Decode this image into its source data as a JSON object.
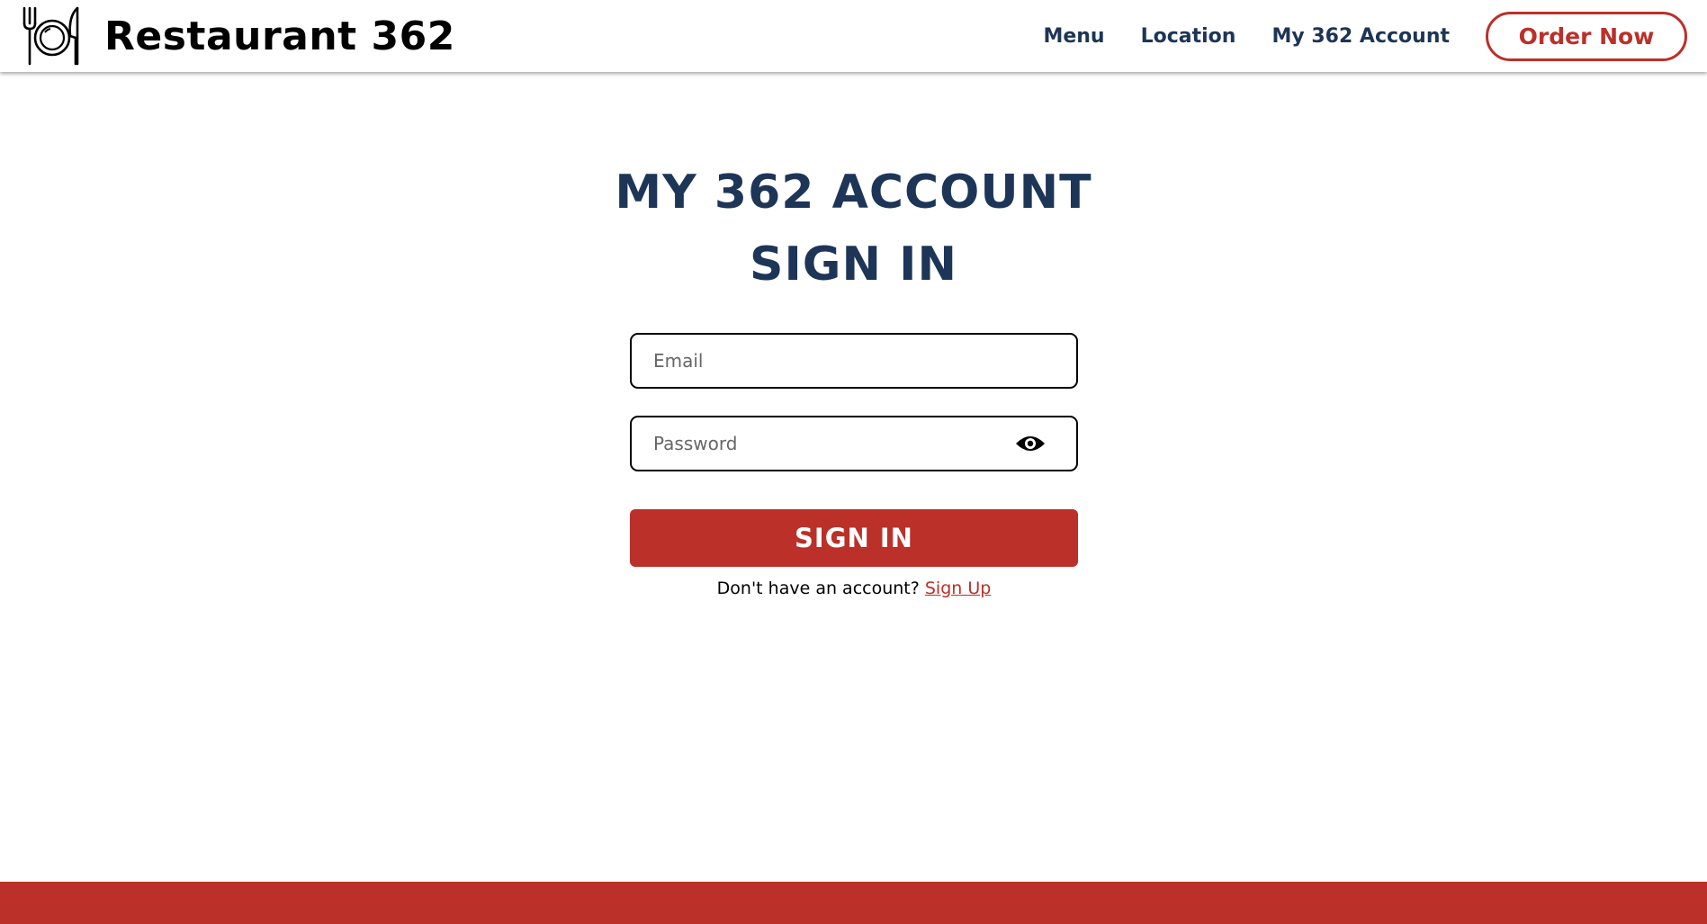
{
  "brand": {
    "name": "Restaurant 362",
    "logo_icon": "plate-fork-knife-icon"
  },
  "nav": {
    "items": [
      {
        "label": "Menu"
      },
      {
        "label": "Location"
      },
      {
        "label": "My 362 Account"
      }
    ],
    "order_button_label": "Order Now"
  },
  "page": {
    "title_line1": "MY 362 ACCOUNT",
    "title_line2": "SIGN IN"
  },
  "form": {
    "email": {
      "value": "",
      "placeholder": "Email"
    },
    "password": {
      "value": "",
      "placeholder": "Password",
      "toggle_icon": "eye-icon"
    },
    "submit_label": "SIGN IN",
    "signup_prompt": "Don't have an account?",
    "signup_link": "Sign Up"
  },
  "colors": {
    "brand_red": "#bb3029",
    "navy": "#1d3557",
    "footer": "#bb3029"
  }
}
